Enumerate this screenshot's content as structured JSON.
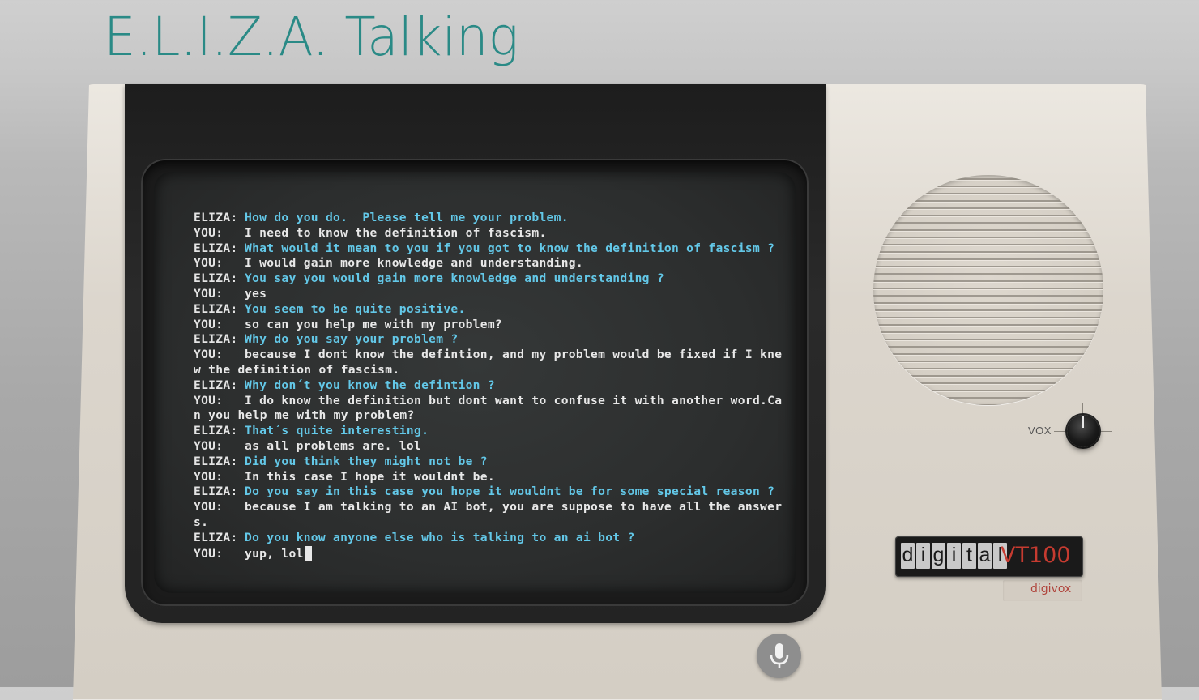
{
  "header": {
    "title": "E.L.I.Z.A. Talking"
  },
  "conversation": [
    {
      "speaker": "ELIZA:",
      "role": "eliza",
      "text": "How do you do.  Please tell me your problem."
    },
    {
      "speaker": "YOU:",
      "role": "you",
      "text": "I need to know the definition of fascism."
    },
    {
      "speaker": "ELIZA:",
      "role": "eliza",
      "text": "What would it mean to you if you got to know the definition of fascism ?"
    },
    {
      "speaker": "YOU:",
      "role": "you",
      "text": "I would gain more knowledge and understanding."
    },
    {
      "speaker": "ELIZA:",
      "role": "eliza",
      "text": "You say you would gain more knowledge and understanding ?"
    },
    {
      "speaker": "YOU:",
      "role": "you",
      "text": "yes"
    },
    {
      "speaker": "ELIZA:",
      "role": "eliza",
      "text": "You seem to be quite positive."
    },
    {
      "speaker": "YOU:",
      "role": "you",
      "text": "so can you help me with my problem?"
    },
    {
      "speaker": "ELIZA:",
      "role": "eliza",
      "text": "Why do you say your problem ?"
    },
    {
      "speaker": "YOU:",
      "role": "you",
      "text": "because I dont know the defintion, and my problem would be fixed if I kne",
      "wrap": "w the definition of fascism."
    },
    {
      "speaker": "ELIZA:",
      "role": "eliza",
      "text": "Why don´t you know the defintion ?"
    },
    {
      "speaker": "YOU:",
      "role": "you",
      "text": "I do know the definition but dont want to confuse it with another word.Ca",
      "wrap": "n you help me with my problem?"
    },
    {
      "speaker": "ELIZA:",
      "role": "eliza",
      "text": "That´s quite interesting."
    },
    {
      "speaker": "YOU:",
      "role": "you",
      "text": "as all problems are. lol"
    },
    {
      "speaker": "ELIZA:",
      "role": "eliza",
      "text": "Did you think they might not be ?"
    },
    {
      "speaker": "YOU:",
      "role": "you",
      "text": "In this case I hope it wouldnt be."
    },
    {
      "speaker": "ELIZA:",
      "role": "eliza",
      "text": "Do you say in this case you hope it wouldnt be for some special reason ?"
    },
    {
      "speaker": "YOU:",
      "role": "you",
      "text": "because I am talking to an AI bot, you are suppose to have all the answer",
      "wrap": "s."
    },
    {
      "speaker": "ELIZA:",
      "role": "eliza",
      "text": "Do you know anyone else who is talking to an ai bot ?"
    }
  ],
  "input": {
    "speaker": "YOU:",
    "value": "yup, lol"
  },
  "controls": {
    "vox_label": "VOX"
  },
  "brand": {
    "letters": [
      "d",
      "i",
      "g",
      "i",
      "t",
      "a",
      "l"
    ],
    "model": "VT100",
    "sub": "digivox"
  },
  "colors": {
    "title": "#2a8a86",
    "eliza_text": "#63c8e8",
    "you_text": "#e8e8e8",
    "brand_model": "#c63b30"
  },
  "icons": {
    "mic": "microphone-icon",
    "knob": "volume-knob"
  }
}
